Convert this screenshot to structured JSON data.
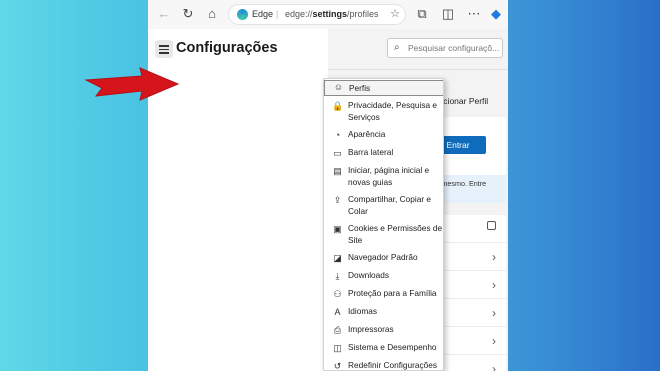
{
  "browser": {
    "site_label": "Edge",
    "url_prefix": "edge://",
    "url_bold": "settings",
    "url_suffix": "/profiles",
    "icons": [
      "back-icon",
      "refresh-icon",
      "home-icon",
      "star-icon",
      "extensions-icon",
      "split-screen-icon",
      "copilot-icon"
    ]
  },
  "settings": {
    "title": "Configurações",
    "search_placeholder": "Pesquisar configuraçõ..."
  },
  "menu": {
    "items": [
      {
        "label": "Perfis",
        "icon": "profile-icon",
        "glyph": "☺"
      },
      {
        "label": "Privacidade, Pesquisa e Serviços",
        "icon": "lock-icon",
        "glyph": "🔒"
      },
      {
        "label": "Aparência",
        "icon": "palette-icon",
        "glyph": "◔"
      },
      {
        "label": "Barra lateral",
        "icon": "sidebar-icon",
        "glyph": "▭"
      },
      {
        "label": "Iniciar, página inicial e novas guias",
        "icon": "start-page-icon",
        "glyph": "▤"
      },
      {
        "label": "Compartilhar, Copiar e Colar",
        "icon": "share-icon",
        "glyph": "⇪"
      },
      {
        "label": "Cookies e Permissões de Site",
        "icon": "cookies-icon",
        "glyph": "▣"
      },
      {
        "label": "Navegador Padrão",
        "icon": "default-browser-icon",
        "glyph": "◪"
      },
      {
        "label": "Downloads",
        "icon": "download-icon",
        "glyph": "⤓"
      },
      {
        "label": "Proteção para a Família",
        "icon": "family-icon",
        "glyph": "⚇"
      },
      {
        "label": "Idiomas",
        "icon": "language-icon",
        "glyph": "A"
      },
      {
        "label": "Impressoras",
        "icon": "printer-icon",
        "glyph": "⎙"
      },
      {
        "label": "Sistema e Desempenho",
        "icon": "system-icon",
        "glyph": "◫"
      },
      {
        "label": "Redefinir Configurações",
        "icon": "reset-icon",
        "glyph": "↺"
      }
    ]
  },
  "profiles": {
    "add_profile": "Adicionar Perfil",
    "enter_button": "Entrar",
    "more": "···",
    "notice": "s precisamos confirmar que é você mesmo. Entre"
  },
  "colors": {
    "accent": "#0f6cbd",
    "arrow": "#d6141c"
  }
}
